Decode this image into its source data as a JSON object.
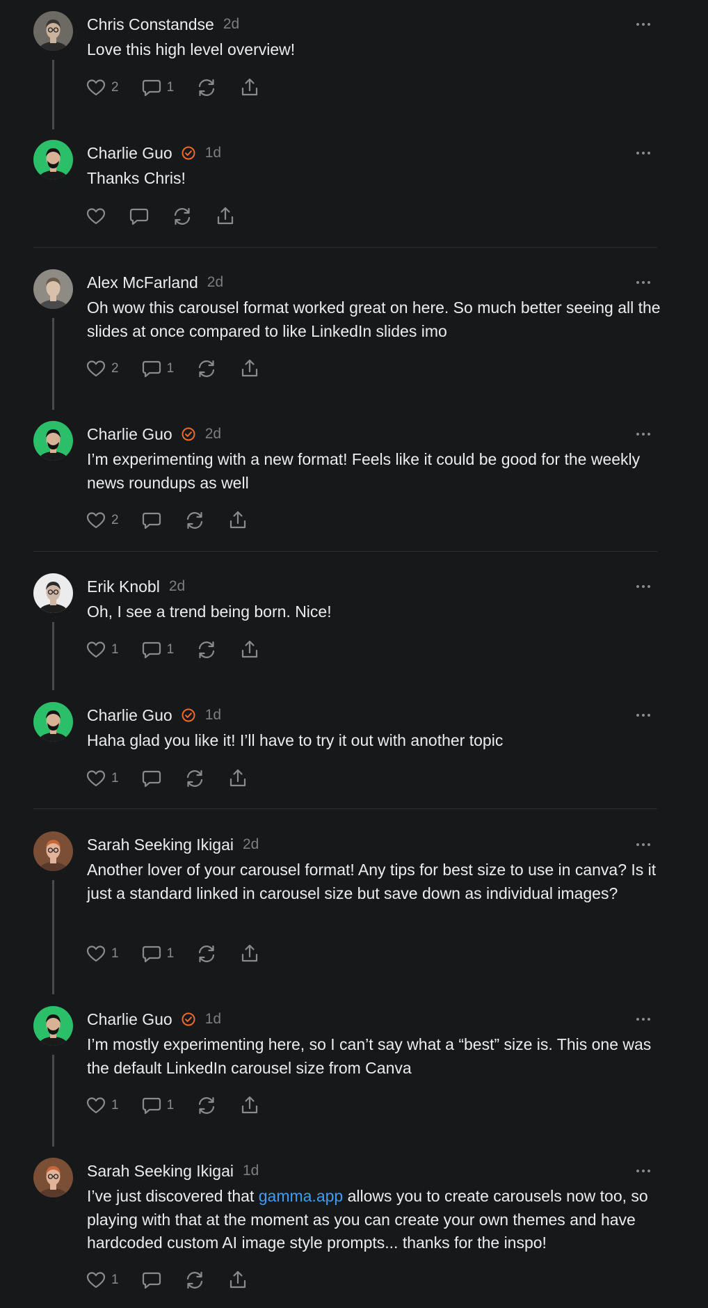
{
  "colors": {
    "background": "#17181a",
    "verified_badge": "#f06b2b",
    "link": "#3f9cf0",
    "muted": "#8a8b8e"
  },
  "comments": [
    {
      "name": "Chris Constandse",
      "verified": false,
      "time": "2d",
      "text": "Love this high level overview!",
      "likes": "2",
      "replies": "1",
      "avatar": "chris"
    },
    {
      "name": "Charlie Guo",
      "verified": true,
      "time": "1d",
      "text": "Thanks Chris!",
      "likes": "",
      "replies": "",
      "avatar": "charlie"
    },
    {
      "name": "Alex McFarland",
      "verified": false,
      "time": "2d",
      "text": "Oh wow this carousel format worked great on here. So much better seeing all the slides at once compared to like LinkedIn slides imo",
      "likes": "2",
      "replies": "1",
      "avatar": "alex"
    },
    {
      "name": "Charlie Guo",
      "verified": true,
      "time": "2d",
      "text": "I’m experimenting with a new format! Feels like it could be good for the weekly news roundups as well",
      "likes": "2",
      "replies": "",
      "avatar": "charlie"
    },
    {
      "name": "Erik Knobl",
      "verified": false,
      "time": "2d",
      "text": "Oh, I see a trend being born. Nice!",
      "likes": "1",
      "replies": "1",
      "avatar": "erik"
    },
    {
      "name": "Charlie Guo",
      "verified": true,
      "time": "1d",
      "text": "Haha glad you like it! I’ll have to try it out with another topic",
      "likes": "1",
      "replies": "",
      "avatar": "charlie"
    },
    {
      "name": "Sarah Seeking Ikigai",
      "verified": false,
      "time": "2d",
      "text": "Another lover of your carousel format! Any tips for best size to use in canva? Is it just a standard linked in carousel size but save down as individual images?",
      "likes": "1",
      "replies": "1",
      "avatar": "sarah"
    },
    {
      "name": "Charlie Guo",
      "verified": true,
      "time": "1d",
      "text": "I’m mostly experimenting here, so I can’t say what a “best” size is. This one was the default LinkedIn carousel size from Canva",
      "likes": "1",
      "replies": "1",
      "avatar": "charlie"
    },
    {
      "name": "Sarah Seeking Ikigai",
      "verified": false,
      "time": "1d",
      "text_before": "I’ve just discovered that ",
      "link": "gamma.app",
      "text_after": " allows you to create carousels now too, so playing with that at the moment as you can create your own themes and have hardcoded custom AI image style prompts... thanks for the inspo!",
      "likes": "1",
      "replies": "",
      "avatar": "sarah"
    }
  ]
}
